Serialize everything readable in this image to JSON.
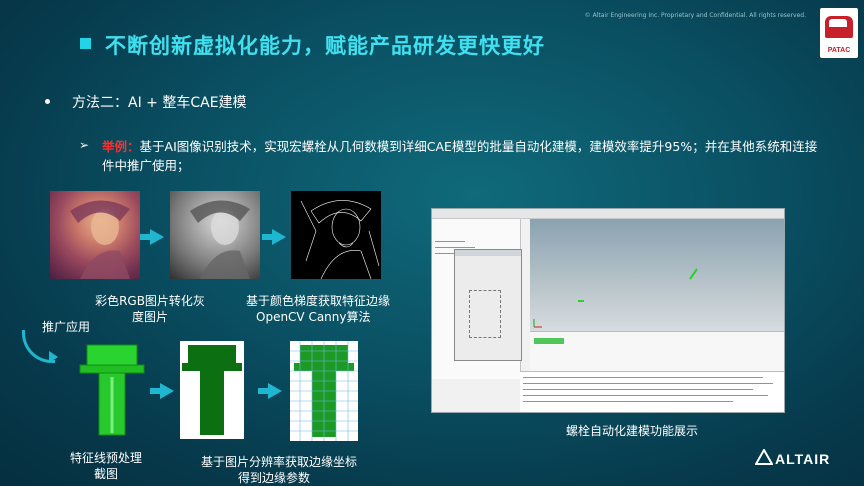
{
  "header": {
    "copyright": "© Altair Engineering Inc. Proprietary and Confidential. All rights reserved.",
    "title": "不断创新虚拟化能力，赋能产品研发更快更好",
    "logo_text": "PATAC"
  },
  "content": {
    "method": "方法二：AI + 整车CAE建模",
    "example_label": "举例：",
    "example_text": "基于AI图像识别技术，实现宏螺栓从几何数模到详细CAE模型的批量自动化建模，建模效率提升95%；并在其他系统和连接件中推广使用；"
  },
  "pipeline": {
    "caption_color_to_gray": "彩色RGB图片转化灰度图片",
    "caption_edge_line1": "基于颜色梯度获取特征边缘",
    "caption_edge_line2": "OpenCV  Canny算法",
    "spread_label": "推广应用",
    "caption_preprocess_line1": "特征线预处理",
    "caption_preprocess_line2": "截图",
    "caption_coords_line1": "基于图片分辨率获取边缘坐标",
    "caption_coords_line2": "得到边缘参数"
  },
  "screenshot": {
    "caption": "螺栓自动化建模功能展示"
  },
  "footer": {
    "brand": "ALTAIR"
  },
  "colors": {
    "title": "#3fe0ef",
    "accent_arrow": "#1fb6cf",
    "example_label": "#ff2f2f",
    "bolt_green": "#22c42a",
    "bolt_dark_green": "#0c6f12"
  }
}
